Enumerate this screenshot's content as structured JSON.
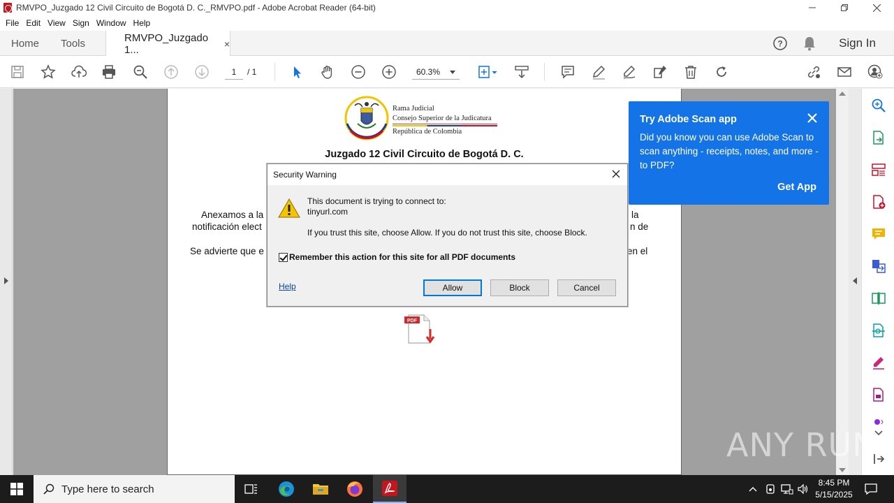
{
  "window": {
    "title": "RMVPO_Juzgado 12 Civil Circuito de Bogotá D. C._RMVPO.pdf - Adobe Acrobat Reader (64-bit)",
    "controls": [
      "minimize",
      "restore",
      "close"
    ]
  },
  "menu": [
    "File",
    "Edit",
    "View",
    "Sign",
    "Window",
    "Help"
  ],
  "tabs": {
    "home": "Home",
    "tools": "Tools",
    "document": "RMVPO_Juzgado 1...",
    "close": "×"
  },
  "header": {
    "sign_in": "Sign In"
  },
  "toolbar": {
    "page_current": "1",
    "page_total": "/ 1",
    "zoom": "60.3%"
  },
  "document": {
    "org_line1": "Rama Judicial",
    "org_line2": "Consejo Superior de la Judicatura",
    "org_line3": "República de Colombia",
    "heading": "Juzgado 12 Civil Circuito de Bogotá D. C.",
    "line1_left": "Anexamos a la",
    "line1_right": "la",
    "line2_left": "notificación elect",
    "line2_right": "n de",
    "line3_left": "Se advierte que e",
    "line3_right": "en el"
  },
  "dialog": {
    "title": "Security Warning",
    "msg1": "This document is trying to connect to:",
    "msg2": "tinyurl.com",
    "msg3": "If you trust this site, choose Allow. If you do not trust this site, choose Block.",
    "checkbox_label": "Remember this action for this site for all PDF documents",
    "checkbox_checked": true,
    "help": "Help",
    "allow": "Allow",
    "block": "Block",
    "cancel": "Cancel"
  },
  "scan_popup": {
    "title": "Try Adobe Scan app",
    "body": "Did you know you can use Adobe Scan to scan anything - receipts, notes, and more - to PDF?",
    "cta": "Get App"
  },
  "watermark": "ANY RUN",
  "taskbar": {
    "search_placeholder": "Type here to search",
    "time": "8:45 PM",
    "date": "5/15/2025"
  },
  "colors": {
    "accent_blue": "#1473e6",
    "acrobat_red": "#c4161c",
    "taskbar_bg": "#1c1c1c"
  }
}
